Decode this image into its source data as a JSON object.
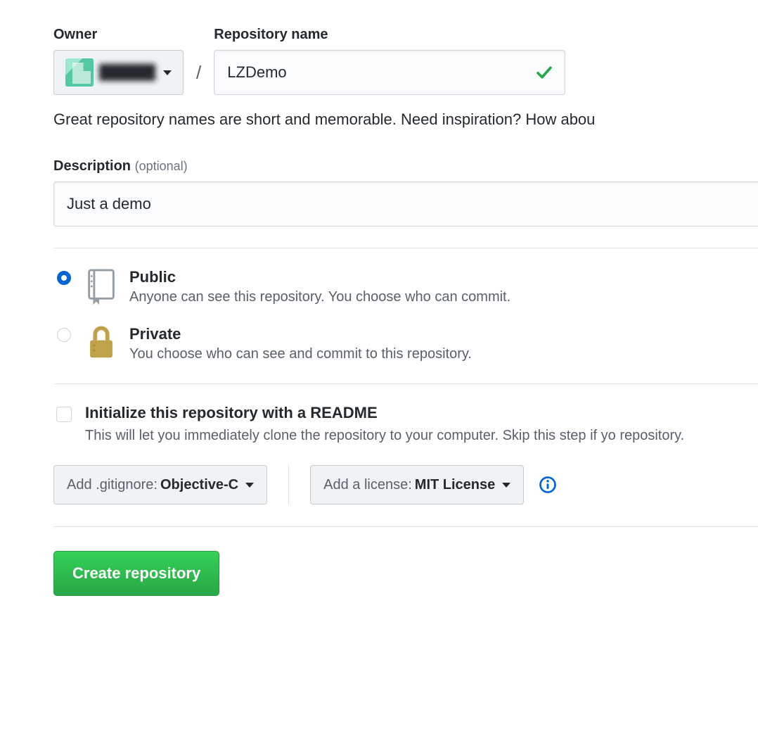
{
  "labels": {
    "owner": "Owner",
    "repo_name": "Repository name",
    "description": "Description",
    "optional": "(optional)"
  },
  "owner": {
    "display_name": "██████"
  },
  "repo": {
    "name_value": "LZDemo",
    "name_valid": true
  },
  "hint": "Great repository names are short and memorable. Need inspiration? How abou",
  "description_value": "Just a demo",
  "visibility": {
    "selected": "public",
    "public": {
      "title": "Public",
      "sub": "Anyone can see this repository. You choose who can commit."
    },
    "private": {
      "title": "Private",
      "sub": "You choose who can see and commit to this repository."
    }
  },
  "readme": {
    "checked": false,
    "title": "Initialize this repository with a README",
    "sub": "This will let you immediately clone the repository to your computer. Skip this step if yo repository."
  },
  "gitignore": {
    "prefix": "Add .gitignore:",
    "value": "Objective-C"
  },
  "license": {
    "prefix": "Add a license:",
    "value": "MIT License"
  },
  "actions": {
    "create": "Create repository"
  }
}
